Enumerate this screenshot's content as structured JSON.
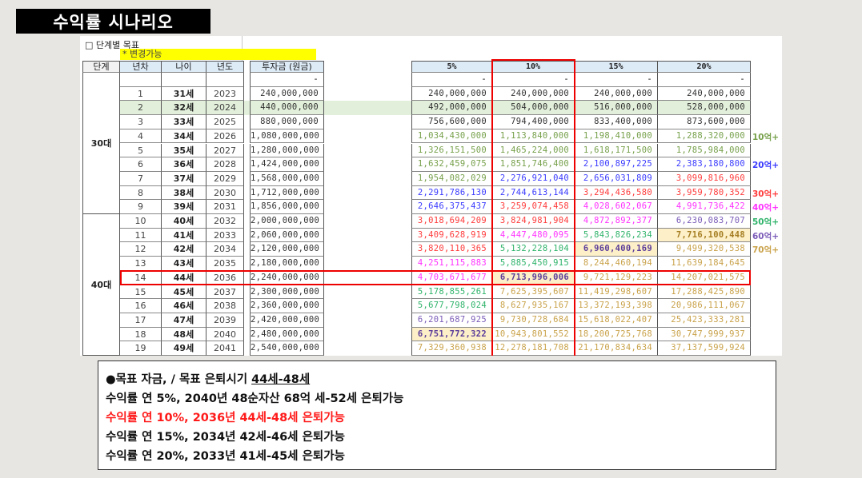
{
  "title": "수익률 시나리오",
  "sheet": {
    "goal_label": "□ 단계별 목표",
    "editable_note": "* 변경가능",
    "headers": {
      "stage": "단계",
      "year_no": "년차",
      "age": "나이",
      "year": "년도",
      "principal": "투자금 (원금)",
      "rates": [
        "5%",
        "10%",
        "15%",
        "20%"
      ]
    },
    "dash": "-",
    "stages": [
      {
        "label": "30대"
      },
      {
        "label": "40대"
      }
    ],
    "rows": [
      {
        "n": "1",
        "age": "31세",
        "year": "2023",
        "principal": "240,000,000",
        "values": [
          "240,000,000",
          "240,000,000",
          "240,000,000",
          "240,000,000"
        ]
      },
      {
        "n": "2",
        "age": "32세",
        "year": "2024",
        "principal": "440,000,000",
        "values": [
          "492,000,000",
          "504,000,000",
          "516,000,000",
          "528,000,000"
        ]
      },
      {
        "n": "3",
        "age": "33세",
        "year": "2025",
        "principal": "880,000,000",
        "values": [
          "756,600,000",
          "794,400,000",
          "833,400,000",
          "873,600,000"
        ]
      },
      {
        "n": "4",
        "age": "34세",
        "year": "2026",
        "principal": "1,080,000,000",
        "values": [
          "1,034,430,000",
          "1,113,840,000",
          "1,198,410,000",
          "1,288,320,000"
        ]
      },
      {
        "n": "5",
        "age": "35세",
        "year": "2027",
        "principal": "1,280,000,000",
        "values": [
          "1,326,151,500",
          "1,465,224,000",
          "1,618,171,500",
          "1,785,984,000"
        ]
      },
      {
        "n": "6",
        "age": "36세",
        "year": "2028",
        "principal": "1,424,000,000",
        "values": [
          "1,632,459,075",
          "1,851,746,400",
          "2,100,897,225",
          "2,383,180,800"
        ]
      },
      {
        "n": "7",
        "age": "37세",
        "year": "2029",
        "principal": "1,568,000,000",
        "values": [
          "1,954,082,029",
          "2,276,921,040",
          "2,656,031,809",
          "3,099,816,960"
        ]
      },
      {
        "n": "8",
        "age": "38세",
        "year": "2030",
        "principal": "1,712,000,000",
        "values": [
          "2,291,786,130",
          "2,744,613,144",
          "3,294,436,580",
          "3,959,780,352"
        ]
      },
      {
        "n": "9",
        "age": "39세",
        "year": "2031",
        "principal": "1,856,000,000",
        "values": [
          "2,646,375,437",
          "3,259,074,458",
          "4,028,602,067",
          "4,991,736,422"
        ]
      },
      {
        "n": "10",
        "age": "40세",
        "year": "2032",
        "principal": "2,000,000,000",
        "values": [
          "3,018,694,209",
          "3,824,981,904",
          "4,872,892,377",
          "6,230,083,707"
        ]
      },
      {
        "n": "11",
        "age": "41세",
        "year": "2033",
        "principal": "2,060,000,000",
        "values": [
          "3,409,628,919",
          "4,447,480,095",
          "5,843,826,234",
          "7,716,100,448"
        ]
      },
      {
        "n": "12",
        "age": "42세",
        "year": "2034",
        "principal": "2,120,000,000",
        "values": [
          "3,820,110,365",
          "5,132,228,104",
          "6,960,400,169",
          "9,499,320,538"
        ]
      },
      {
        "n": "13",
        "age": "43세",
        "year": "2035",
        "principal": "2,180,000,000",
        "values": [
          "4,251,115,883",
          "5,885,450,915",
          "8,244,460,194",
          "11,639,184,645"
        ]
      },
      {
        "n": "14",
        "age": "44세",
        "year": "2036",
        "principal": "2,240,000,000",
        "values": [
          "4,703,671,677",
          "6,713,996,006",
          "9,721,129,223",
          "14,207,021,575"
        ]
      },
      {
        "n": "15",
        "age": "45세",
        "year": "2037",
        "principal": "2,300,000,000",
        "values": [
          "5,178,855,261",
          "7,625,395,607",
          "11,419,298,607",
          "17,288,425,890"
        ]
      },
      {
        "n": "16",
        "age": "46세",
        "year": "2038",
        "principal": "2,360,000,000",
        "values": [
          "5,677,798,024",
          "8,627,935,167",
          "13,372,193,398",
          "20,986,111,067"
        ]
      },
      {
        "n": "17",
        "age": "47세",
        "year": "2039",
        "principal": "2,420,000,000",
        "values": [
          "6,201,687,925",
          "9,730,728,684",
          "15,618,022,407",
          "25,423,333,281"
        ]
      },
      {
        "n": "18",
        "age": "48세",
        "year": "2040",
        "principal": "2,480,000,000",
        "values": [
          "6,751,772,322",
          "10,943,801,552",
          "18,200,725,768",
          "30,747,999,937"
        ]
      },
      {
        "n": "19",
        "age": "49세",
        "year": "2041",
        "principal": "2,540,000,000",
        "values": [
          "7,329,360,938",
          "12,278,181,708",
          "21,170,834,634",
          "37,137,599,924"
        ]
      }
    ],
    "highlight_cells": [
      [
        11,
        3
      ],
      [
        12,
        2
      ],
      [
        14,
        1
      ],
      [
        18,
        0
      ]
    ],
    "highlight_row_green": 2,
    "selected_row": 14,
    "selected_col": 1,
    "tiers": [
      {
        "label": "10억+",
        "min": 1000000000,
        "color": "#76a04a"
      },
      {
        "label": "20억+",
        "min": 2000000000,
        "color": "#3a3aff"
      },
      {
        "label": "30억+",
        "min": 3000000000,
        "color": "#ff3b3b"
      },
      {
        "label": "40억+",
        "min": 4000000000,
        "color": "#ff33ff"
      },
      {
        "label": "50억+",
        "min": 5000000000,
        "color": "#2fb36a"
      },
      {
        "label": "60억+",
        "min": 6000000000,
        "color": "#7b5cb8"
      },
      {
        "label": "70억+",
        "min": 7000000000,
        "color": "#c9a24a"
      }
    ],
    "default_color": "#333333",
    "highlight_text_color": "#5a3c9a"
  },
  "summary": {
    "heading_prefix": "●목표 자금, / 목표 은퇴시기 ",
    "heading_underlined": "44세-48세",
    "lines": [
      "수익률 연 5%, 2040년 48순자산 68억 세-52세 은퇴가능",
      "수익률 연 10%, 2036년 44세-48세 은퇴가능",
      "수익률 연 15%, 2034년 42세-46세 은퇴가능",
      "수익률 연 20%, 2033년 41세-45세 은퇴가능"
    ],
    "highlight_color": "#ff1a1a"
  }
}
